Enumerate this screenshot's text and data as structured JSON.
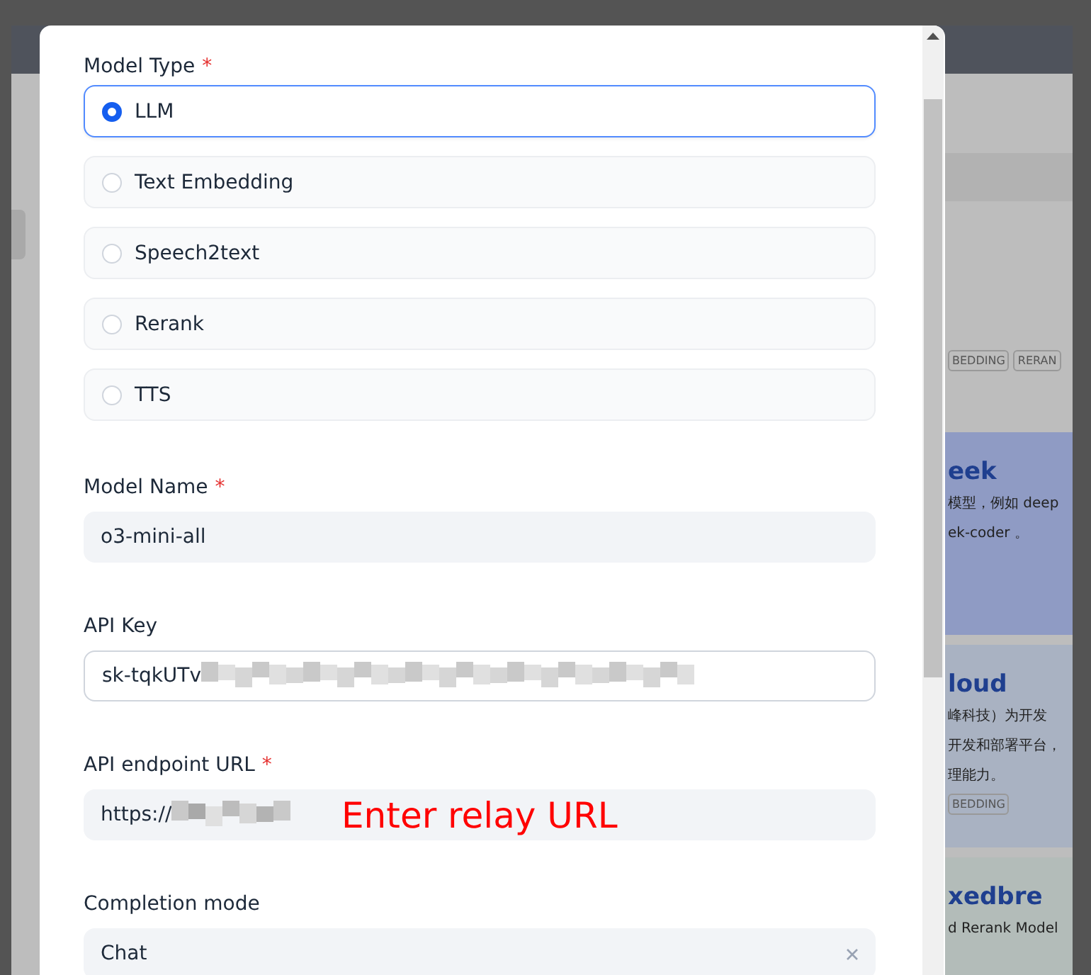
{
  "background_page": {
    "cards": [
      {
        "tags": [
          "BEDDING",
          "RERAN"
        ],
        "color": "#bdbdbd"
      },
      {
        "title": "eek",
        "description": [
          "模型，例如 deep",
          "ek-coder 。"
        ],
        "color": "#8f9bc4"
      },
      {
        "title": "loud",
        "description": [
          "峰科技）为开发",
          "开发和部署平台，",
          "理能力。"
        ],
        "tags": [
          "BEDDING"
        ],
        "color": "#a9b2c2"
      },
      {
        "title": "xedbre",
        "description": [
          "d Rerank Model"
        ],
        "color": "#b3bcb9"
      }
    ]
  },
  "dialog": {
    "model_type": {
      "label": "Model Type",
      "required_mark": "*",
      "options": [
        {
          "label": "LLM",
          "selected": true
        },
        {
          "label": "Text Embedding",
          "selected": false
        },
        {
          "label": "Speech2text",
          "selected": false
        },
        {
          "label": "Rerank",
          "selected": false
        },
        {
          "label": "TTS",
          "selected": false
        }
      ]
    },
    "fields": [
      {
        "label": "Model Name",
        "required_mark": "*",
        "value": "o3-mini-all",
        "kind": "filled"
      },
      {
        "label": "API Key",
        "value": "sk-tqkUTv",
        "kind": "outlined",
        "redacted": true
      },
      {
        "label": "API endpoint URL",
        "required_mark": "*",
        "value": "https://",
        "kind": "filled",
        "redacted": true,
        "annotation": "Enter relay URL"
      },
      {
        "label": "Completion mode",
        "value": "Chat",
        "kind": "select"
      }
    ]
  }
}
